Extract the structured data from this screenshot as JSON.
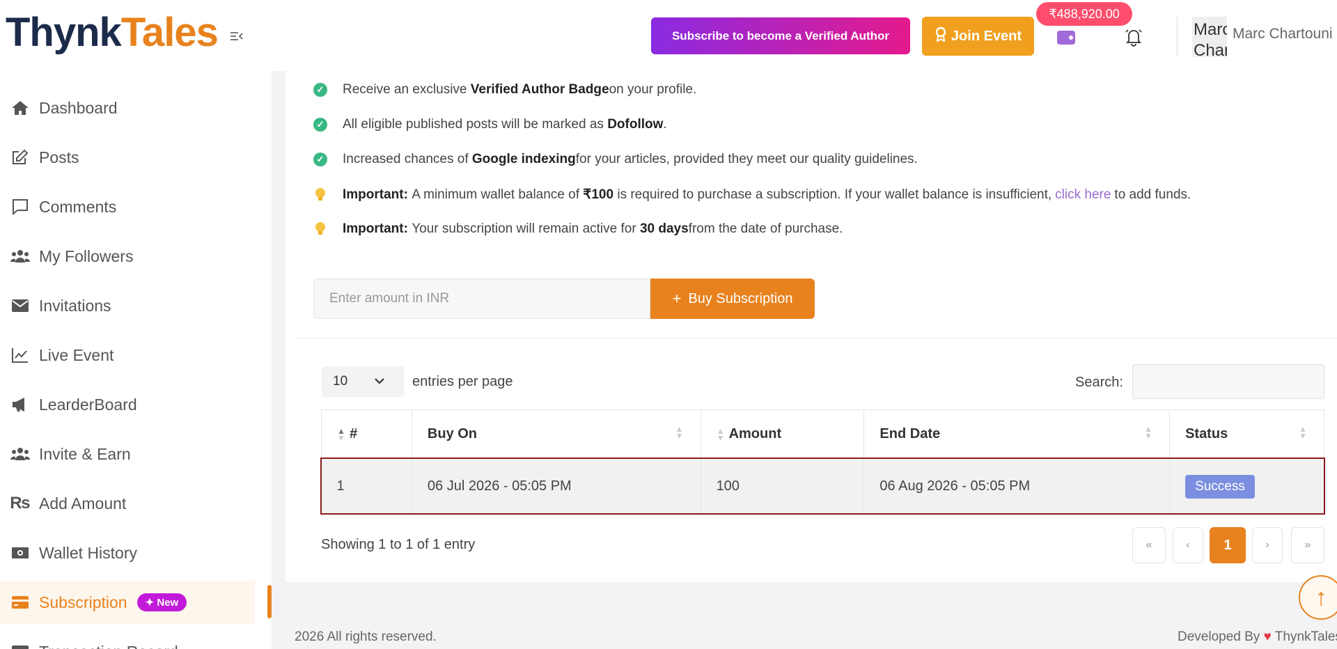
{
  "header": {
    "logo_part1": "Thynk",
    "logo_part2": "Tales",
    "verify_button": "Subscribe to become a Verified Author",
    "join_button": "Join Event",
    "wallet_balance": "₹488,920.00",
    "avatar_alt": "Marc Chartouni",
    "user_name": "Marc Chartouni"
  },
  "sidebar": {
    "items": [
      {
        "label": "Dashboard",
        "icon": "home-icon"
      },
      {
        "label": "Posts",
        "icon": "edit-icon"
      },
      {
        "label": "Comments",
        "icon": "comment-icon"
      },
      {
        "label": "My Followers",
        "icon": "users-icon"
      },
      {
        "label": "Invitations",
        "icon": "envelope-icon"
      },
      {
        "label": "Live Event",
        "icon": "chart-line-icon"
      },
      {
        "label": "LearderBoard",
        "icon": "megaphone-icon"
      },
      {
        "label": "Invite & Earn",
        "icon": "users-icon"
      },
      {
        "label": "Add Amount",
        "icon": "rupee-icon"
      },
      {
        "label": "Wallet History",
        "icon": "money-icon"
      },
      {
        "label": "Subscription",
        "icon": "card-icon",
        "active": true,
        "badge": "✦ New"
      },
      {
        "label": "Transaction Record",
        "icon": "receipt-icon"
      }
    ]
  },
  "benefits": [
    {
      "pre": "Receive an exclusive ",
      "bold": "Verified Author Badge",
      "post": " on your profile."
    },
    {
      "pre": "All eligible published posts will be marked as ",
      "bold": "Dofollow",
      "post": "."
    },
    {
      "pre": "Increased chances of ",
      "bold": "Google indexing",
      "post": " for your articles, provided they meet our quality guidelines."
    }
  ],
  "notes": {
    "note1_label": "Important:",
    "note1_pre": " A minimum wallet balance of ",
    "note1_amount": "₹100",
    "note1_mid": " is required to purchase a subscription. If your wallet balance is insufficient,",
    "note1_link": "click here",
    "note1_post": "to add funds.",
    "note2_label": "Important:",
    "note2_pre": " Your subscription will remain active for ",
    "note2_bold": "30 days",
    "note2_post": " from the date of purchase."
  },
  "purchase": {
    "amount_placeholder": "Enter amount in INR",
    "buy_button": "Buy Subscription"
  },
  "table_controls": {
    "entries_value": "10",
    "entries_label": "entries per page",
    "search_label": "Search:"
  },
  "table": {
    "columns": [
      "#",
      "Buy On",
      "Amount",
      "End Date",
      "Status"
    ],
    "rows": [
      {
        "index": "1",
        "buy_on": "06 Jul 2026 - 05:05 PM",
        "amount": "100",
        "end_date": "06 Aug 2026 - 05:05 PM",
        "status": "Success"
      }
    ]
  },
  "pagination": {
    "showing": "Showing 1 to 1 of 1 entry",
    "first": "«",
    "prev": "‹",
    "current": "1",
    "next": "›",
    "last": "»"
  },
  "footer": {
    "left": "2026 All rights reserved.",
    "right_pre": "Developed By",
    "right_brand": "ThynkTales"
  },
  "colors": {
    "accent": "#e8821e",
    "brand_dark": "#1c2b4a",
    "success_badge": "#7b8ee0",
    "check": "#3ab883",
    "new_badge": "#c21ad9"
  }
}
